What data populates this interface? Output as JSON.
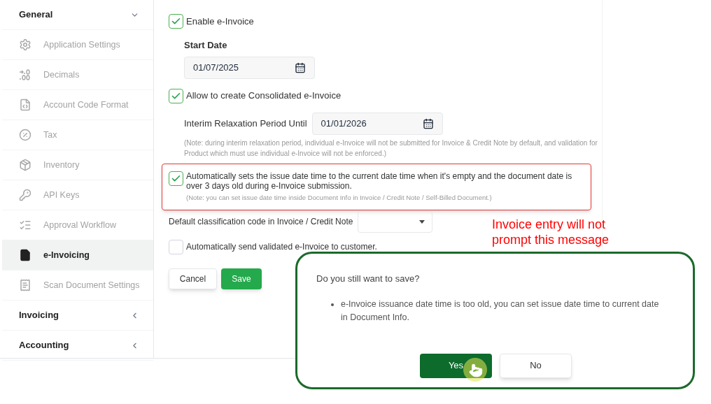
{
  "sidebar": {
    "items": [
      {
        "kind": "group",
        "label": "General",
        "expanded": true
      },
      {
        "kind": "item",
        "label": "Application Settings",
        "selected": false
      },
      {
        "kind": "item",
        "label": "Decimals",
        "selected": false
      },
      {
        "kind": "item",
        "label": "Account Code Format",
        "selected": false
      },
      {
        "kind": "item",
        "label": "Tax",
        "selected": false
      },
      {
        "kind": "item",
        "label": "Inventory",
        "selected": false
      },
      {
        "kind": "item",
        "label": "API Keys",
        "selected": false
      },
      {
        "kind": "item",
        "label": "Approval Workflow",
        "selected": false
      },
      {
        "kind": "item",
        "label": "e-Invoicing",
        "selected": true
      },
      {
        "kind": "item",
        "label": "Scan Document Settings",
        "selected": false
      },
      {
        "kind": "group",
        "label": "Invoicing",
        "expanded": false
      },
      {
        "kind": "group",
        "label": "Accounting",
        "expanded": false
      }
    ]
  },
  "form": {
    "enable": {
      "label": "Enable e-Invoice",
      "checked": true
    },
    "start_date": {
      "label": "Start Date",
      "value": "01/07/2025"
    },
    "consolidated": {
      "label": "Allow to create Consolidated e-Invoice",
      "checked": true
    },
    "interim": {
      "label": "Interim Relaxation Period Until",
      "value": "01/01/2026",
      "note": "(Note: during interim relaxation period, individual e-Invoice will not be submitted for Invoice & Credit Note by default, and validation for Product which must use individual e-Invoice will not be enforced.)"
    },
    "auto_issue": {
      "label": "Automatically sets the issue date time to the current date time when it's empty and the document date is over 3 days old during e-Invoice submission.",
      "checked": true,
      "note": "(Note: you can set issue date time inside Document Info in Invoice / Credit Note / Self-Billed Document.)"
    },
    "classification": {
      "label": "Default classification code in Invoice / Credit Note"
    },
    "auto_send": {
      "label": "Automatically send validated e-Invoice to customer.",
      "checked": false
    },
    "buttons": [
      "Cancel",
      "Save"
    ]
  },
  "annotation": "Invoice entry will not prompt this message",
  "dialog": {
    "title": "Do you still want to save?",
    "bullets": [
      "e-Invoice issuance date time is too old, you can set issue date time to current date in Document Info."
    ],
    "buttons": [
      "Yes",
      "No"
    ]
  }
}
